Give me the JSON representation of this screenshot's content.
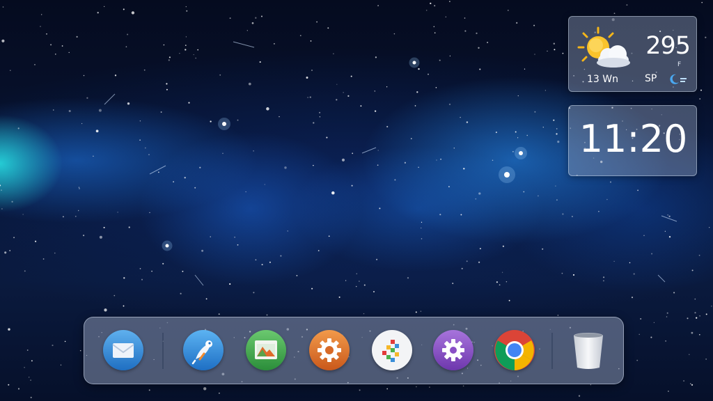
{
  "weather_widget": {
    "temperature": "295",
    "temperature_sub": "F",
    "location": "13 Wn",
    "condition": "SP",
    "icon": "partly-cloudy-icon",
    "secondary_icon": "moon-icon"
  },
  "clock_widget": {
    "time": "11:20"
  },
  "dock": {
    "items": [
      {
        "name": "mail-app",
        "icon": "envelope-icon",
        "color": "#2f83d6"
      },
      {
        "name": "bird-app",
        "icon": "bird-icon",
        "color": "#2f86d8"
      },
      {
        "name": "image-viewer-app",
        "icon": "picture-icon",
        "color": "#3fa54a"
      },
      {
        "name": "settings-app",
        "icon": "gear-icon",
        "color": "#e27a2a"
      },
      {
        "name": "software-center-app",
        "icon": "blocks-icon",
        "color": "#f4f4f4"
      },
      {
        "name": "system-settings-app",
        "icon": "gear-icon",
        "color": "#8a4fc6"
      },
      {
        "name": "chrome-browser-app",
        "icon": "chrome-icon",
        "color": "#db4437"
      },
      {
        "name": "trash",
        "icon": "trash-can-icon",
        "color": "#e6e9ee"
      }
    ]
  }
}
